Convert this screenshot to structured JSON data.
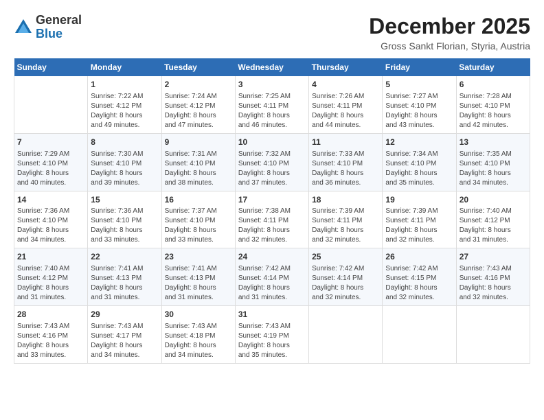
{
  "header": {
    "logo_general": "General",
    "logo_blue": "Blue",
    "month_title": "December 2025",
    "location": "Gross Sankt Florian, Styria, Austria"
  },
  "columns": [
    "Sunday",
    "Monday",
    "Tuesday",
    "Wednesday",
    "Thursday",
    "Friday",
    "Saturday"
  ],
  "weeks": [
    [
      {
        "day": "",
        "content": ""
      },
      {
        "day": "1",
        "content": "Sunrise: 7:22 AM\nSunset: 4:12 PM\nDaylight: 8 hours\nand 49 minutes."
      },
      {
        "day": "2",
        "content": "Sunrise: 7:24 AM\nSunset: 4:12 PM\nDaylight: 8 hours\nand 47 minutes."
      },
      {
        "day": "3",
        "content": "Sunrise: 7:25 AM\nSunset: 4:11 PM\nDaylight: 8 hours\nand 46 minutes."
      },
      {
        "day": "4",
        "content": "Sunrise: 7:26 AM\nSunset: 4:11 PM\nDaylight: 8 hours\nand 44 minutes."
      },
      {
        "day": "5",
        "content": "Sunrise: 7:27 AM\nSunset: 4:10 PM\nDaylight: 8 hours\nand 43 minutes."
      },
      {
        "day": "6",
        "content": "Sunrise: 7:28 AM\nSunset: 4:10 PM\nDaylight: 8 hours\nand 42 minutes."
      }
    ],
    [
      {
        "day": "7",
        "content": "Sunrise: 7:29 AM\nSunset: 4:10 PM\nDaylight: 8 hours\nand 40 minutes."
      },
      {
        "day": "8",
        "content": "Sunrise: 7:30 AM\nSunset: 4:10 PM\nDaylight: 8 hours\nand 39 minutes."
      },
      {
        "day": "9",
        "content": "Sunrise: 7:31 AM\nSunset: 4:10 PM\nDaylight: 8 hours\nand 38 minutes."
      },
      {
        "day": "10",
        "content": "Sunrise: 7:32 AM\nSunset: 4:10 PM\nDaylight: 8 hours\nand 37 minutes."
      },
      {
        "day": "11",
        "content": "Sunrise: 7:33 AM\nSunset: 4:10 PM\nDaylight: 8 hours\nand 36 minutes."
      },
      {
        "day": "12",
        "content": "Sunrise: 7:34 AM\nSunset: 4:10 PM\nDaylight: 8 hours\nand 35 minutes."
      },
      {
        "day": "13",
        "content": "Sunrise: 7:35 AM\nSunset: 4:10 PM\nDaylight: 8 hours\nand 34 minutes."
      }
    ],
    [
      {
        "day": "14",
        "content": "Sunrise: 7:36 AM\nSunset: 4:10 PM\nDaylight: 8 hours\nand 34 minutes."
      },
      {
        "day": "15",
        "content": "Sunrise: 7:36 AM\nSunset: 4:10 PM\nDaylight: 8 hours\nand 33 minutes."
      },
      {
        "day": "16",
        "content": "Sunrise: 7:37 AM\nSunset: 4:10 PM\nDaylight: 8 hours\nand 33 minutes."
      },
      {
        "day": "17",
        "content": "Sunrise: 7:38 AM\nSunset: 4:11 PM\nDaylight: 8 hours\nand 32 minutes."
      },
      {
        "day": "18",
        "content": "Sunrise: 7:39 AM\nSunset: 4:11 PM\nDaylight: 8 hours\nand 32 minutes."
      },
      {
        "day": "19",
        "content": "Sunrise: 7:39 AM\nSunset: 4:11 PM\nDaylight: 8 hours\nand 32 minutes."
      },
      {
        "day": "20",
        "content": "Sunrise: 7:40 AM\nSunset: 4:12 PM\nDaylight: 8 hours\nand 31 minutes."
      }
    ],
    [
      {
        "day": "21",
        "content": "Sunrise: 7:40 AM\nSunset: 4:12 PM\nDaylight: 8 hours\nand 31 minutes."
      },
      {
        "day": "22",
        "content": "Sunrise: 7:41 AM\nSunset: 4:13 PM\nDaylight: 8 hours\nand 31 minutes."
      },
      {
        "day": "23",
        "content": "Sunrise: 7:41 AM\nSunset: 4:13 PM\nDaylight: 8 hours\nand 31 minutes."
      },
      {
        "day": "24",
        "content": "Sunrise: 7:42 AM\nSunset: 4:14 PM\nDaylight: 8 hours\nand 31 minutes."
      },
      {
        "day": "25",
        "content": "Sunrise: 7:42 AM\nSunset: 4:14 PM\nDaylight: 8 hours\nand 32 minutes."
      },
      {
        "day": "26",
        "content": "Sunrise: 7:42 AM\nSunset: 4:15 PM\nDaylight: 8 hours\nand 32 minutes."
      },
      {
        "day": "27",
        "content": "Sunrise: 7:43 AM\nSunset: 4:16 PM\nDaylight: 8 hours\nand 32 minutes."
      }
    ],
    [
      {
        "day": "28",
        "content": "Sunrise: 7:43 AM\nSunset: 4:16 PM\nDaylight: 8 hours\nand 33 minutes."
      },
      {
        "day": "29",
        "content": "Sunrise: 7:43 AM\nSunset: 4:17 PM\nDaylight: 8 hours\nand 34 minutes."
      },
      {
        "day": "30",
        "content": "Sunrise: 7:43 AM\nSunset: 4:18 PM\nDaylight: 8 hours\nand 34 minutes."
      },
      {
        "day": "31",
        "content": "Sunrise: 7:43 AM\nSunset: 4:19 PM\nDaylight: 8 hours\nand 35 minutes."
      },
      {
        "day": "",
        "content": ""
      },
      {
        "day": "",
        "content": ""
      },
      {
        "day": "",
        "content": ""
      }
    ]
  ]
}
